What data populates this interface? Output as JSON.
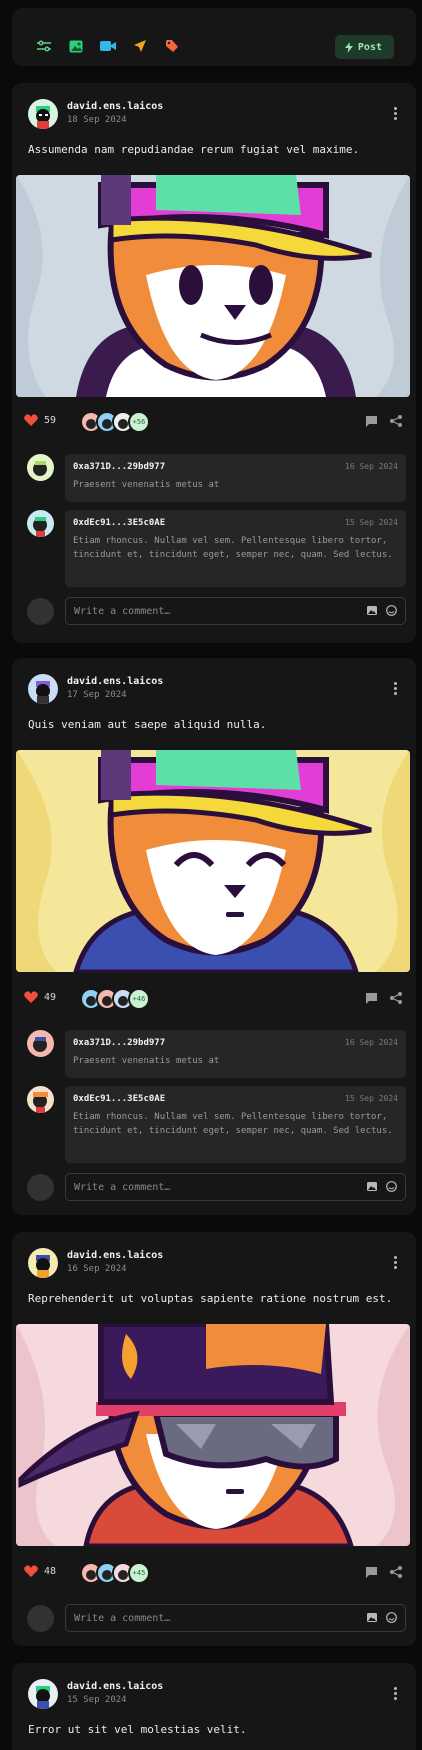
{
  "composer": {
    "post_label": "Post"
  },
  "posts": [
    {
      "author": "david.ens.laicos",
      "date": "18 Sep 2024",
      "text": "Assumenda nam repudiandae rerum fugiat vel maxime.",
      "likes": "59",
      "more_likers": "+56",
      "comments": [
        {
          "author": "0xa371D...29bd977",
          "date": "16 Sep 2024",
          "text": "Praesent venenatis metus at"
        },
        {
          "author": "0xdEc91...3E5c0AE",
          "date": "15 Sep 2024",
          "text": "Etiam rhoncus. Nullam vel sem. Pellentesque libero tortor, tincidunt et, tincidunt eget, semper nec, quam. Sed lectus."
        }
      ],
      "comment_placeholder": "Write a comment…"
    },
    {
      "author": "david.ens.laicos",
      "date": "17 Sep 2024",
      "text": "Quis veniam aut saepe aliquid nulla.",
      "likes": "49",
      "more_likers": "+46",
      "comments": [
        {
          "author": "0xa371D...29bd977",
          "date": "16 Sep 2024",
          "text": "Praesent venenatis metus at"
        },
        {
          "author": "0xdEc91...3E5c0AE",
          "date": "15 Sep 2024",
          "text": "Etiam rhoncus. Nullam vel sem. Pellentesque libero tortor, tincidunt et, tincidunt eget, semper nec, quam. Sed lectus."
        }
      ],
      "comment_placeholder": "Write a comment…"
    },
    {
      "author": "david.ens.laicos",
      "date": "16 Sep 2024",
      "text": "Reprehenderit ut voluptas sapiente ratione nostrum est.",
      "likes": "48",
      "more_likers": "+45",
      "comment_placeholder": "Write a comment…"
    },
    {
      "author": "david.ens.laicos",
      "date": "15 Sep 2024",
      "text": "Error ut sit vel molestias velit."
    }
  ],
  "colors": {
    "accent_green": "#1d3a2a",
    "like_red": "#f0503c",
    "card_bg": "#161616"
  }
}
